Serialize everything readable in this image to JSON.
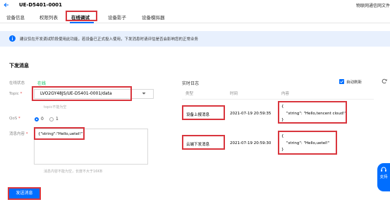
{
  "header": {
    "title": "UE-D5401-0001",
    "right_text": "物联网通信网文件"
  },
  "tabs": [
    {
      "label": "设备信息",
      "active": false
    },
    {
      "label": "权限列表",
      "active": false
    },
    {
      "label": "在线调试",
      "active": true
    },
    {
      "label": "设备影子",
      "active": false
    },
    {
      "label": "设备模拟器",
      "active": false
    }
  ],
  "notice": {
    "text": "建议仅在开发调试阶段使用此功能，若设备已正式投入使用，下发消息时请评估是否会影响您的正常业务"
  },
  "send_section": {
    "title": "下发消息",
    "status_label": "在线状态",
    "status_value": "在线",
    "topic_label": "Topic",
    "topic_value": "LVO2GY48JS/UE-D5401-0001/data",
    "topic_hint": "topic不能为空",
    "qos_label": "QoS",
    "qos_options": [
      "0",
      "1"
    ],
    "qos_selected": "0",
    "message_label": "消息内容",
    "message_value": "{\"string\":\"Hello,uetel!\"}",
    "message_hint": "消息内容不能为空，长度不大于16KB",
    "send_button": "发送消息"
  },
  "log_section": {
    "title": "实时日志",
    "auto_refresh_label": "自动刷新",
    "auto_refresh_checked": true,
    "columns": [
      "类型",
      "时间",
      "内容"
    ],
    "rows": [
      {
        "type": "设备上报消息",
        "time": "2021-07-19 20:59:35",
        "content": [
          "{",
          "\"string\": \"Hello,tencent cloud!\"",
          "}"
        ]
      },
      {
        "type": "云端下发消息",
        "time": "2021-07-19 20:59:30",
        "content": [
          "{",
          "\"string\": \"Hello,uetel!\"",
          "}"
        ]
      }
    ]
  },
  "support": {
    "label": "支持"
  },
  "colors": {
    "accent": "#006eff",
    "online": "#0abf5b",
    "highlight": "#d9363e",
    "notice_bg": "#e8f0fd"
  }
}
